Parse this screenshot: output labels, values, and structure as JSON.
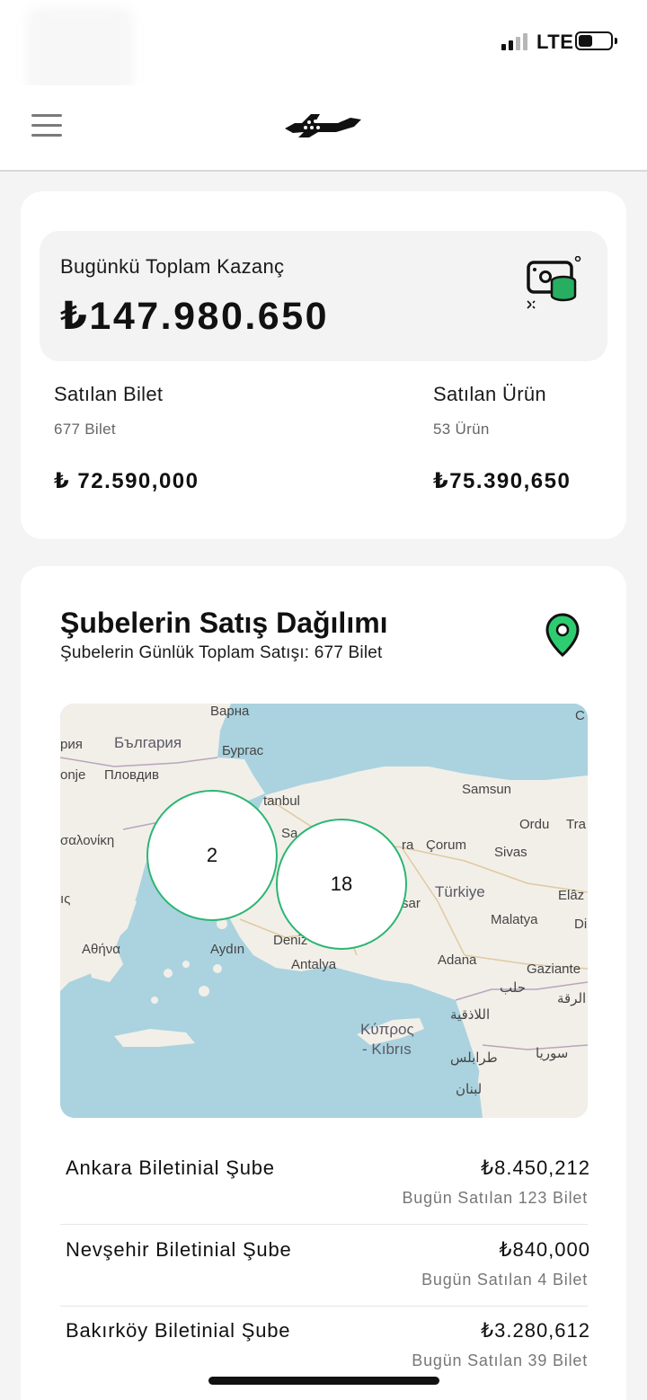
{
  "status_bar": {
    "network": "LTE",
    "signal_bars": 4,
    "signal_bars_filled": 2,
    "battery_level": 0.4
  },
  "header": {
    "menu_icon": "hamburger-menu-icon",
    "logo_icon": "airplane-logo-icon"
  },
  "earnings": {
    "total_label": "Bugünkü Toplam Kazanç",
    "total_value": "₺147.980.650",
    "icon": "money-coins-icon",
    "tickets": {
      "title": "Satılan Bilet",
      "count": "677 Bilet",
      "amount": "₺ 72.590,000"
    },
    "products": {
      "title": "Satılan Ürün",
      "count": "53 Ürün",
      "amount": "₺75.390,650"
    }
  },
  "branches": {
    "title": "Şubelerin Satış Dağılımı",
    "subtitle": "Şubelerin Günlük Toplam Satışı: 677 Bilet",
    "icon": "location-pin-icon",
    "map": {
      "labels": {
        "varna": "Варна",
        "bulgaria": "България",
        "burgas": "Бургас",
        "ria": "рия",
        "plovdiv": "Пловдив",
        "onje": "onje",
        "istanbul": "tanbul",
        "samsun": "Samsun",
        "ordu": "Ordu",
        "tra": "Tra",
        "selonika": "σαλονίκη",
        "sa": "Sa",
        "ra": "ra",
        "corum": "Çorum",
        "sivas": "Sivas",
        "turkiye": "Türkiye",
        "elaz": "Elâz",
        "ic": "ıς",
        "sar": "sar",
        "malatya": "Malatya",
        "di": "Di",
        "athina": "Αθήνα",
        "aydin": "Aydın",
        "deniz": "Deniz",
        "adana": "Adana",
        "gaziante": "Gaziante",
        "antalya": "Antalya",
        "halab": "حلب",
        "raqqa": "الرقة",
        "latakia": "اللاذقية",
        "kypros": "Κύπρος",
        "kibris": "- Kıbrıs",
        "suriya": "سوريا",
        "tarablus": "طرابلس",
        "lubnan": "لبنان",
        "c": "C"
      },
      "clusters": [
        {
          "count": "2"
        },
        {
          "count": "18"
        }
      ]
    },
    "items": [
      {
        "name": "Ankara Biletinial Şube",
        "amount": "₺8.450,212",
        "sold": "Bugün Satılan 123 Bilet"
      },
      {
        "name": "Nevşehir Biletinial Şube",
        "amount": "₺840,000",
        "sold": "Bugün Satılan 4 Bilet"
      },
      {
        "name": "Bakırköy Biletinial Şube",
        "amount": "₺3.280,612",
        "sold": "Bugün Satılan 39 Bilet"
      }
    ]
  },
  "colors": {
    "accent": "#2bb673",
    "pin": "#2ecc71",
    "coins": "#27ae60",
    "map_water": "#aad3df",
    "map_land": "#f2efe9"
  }
}
